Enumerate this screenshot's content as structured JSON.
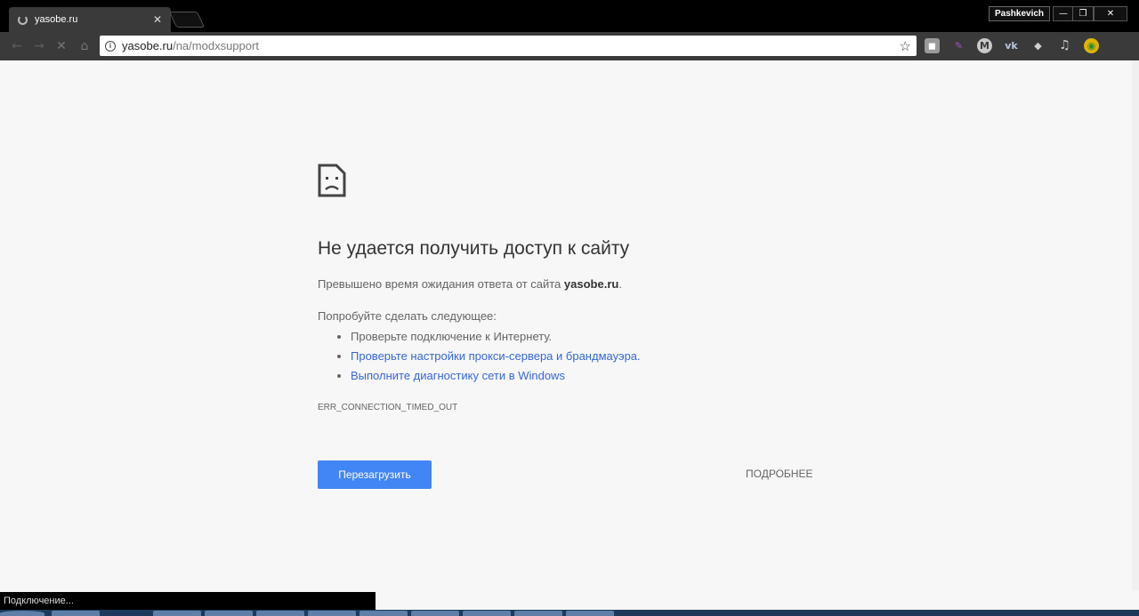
{
  "browser": {
    "tab_title": "yasobe.ru",
    "tab_close": "✕",
    "profile_name": "Pashkevich",
    "window_buttons": [
      "—",
      "❐",
      "✕"
    ],
    "url_host": "yasobe.ru",
    "url_path": "/na/modxsupport",
    "star_glyph": "☆",
    "extensions": [
      {
        "name": "rss-extension-icon",
        "color": "#9a9a9a",
        "glyph": "◼"
      },
      {
        "name": "feather-extension-icon",
        "color": "#8b3fb8",
        "glyph": "✎"
      },
      {
        "name": "m-extension-icon",
        "color": "#c8c8c8",
        "glyph": "M"
      },
      {
        "name": "vk-extension-icon",
        "color": "#5b7fa6",
        "glyph": "vk"
      },
      {
        "name": "layers-extension-icon",
        "color": "#d0d0d0",
        "glyph": "◆"
      },
      {
        "name": "music-extension-icon",
        "color": "#bbbbbb",
        "glyph": "♫"
      },
      {
        "name": "chrome-extension-icon",
        "color": "#e0b400",
        "glyph": "◉"
      }
    ]
  },
  "error": {
    "heading": "Не удается получить доступ к сайту",
    "summary_prefix": "Превышено время ожидания ответа от сайта ",
    "summary_host": "yasobe.ru",
    "summary_suffix": ".",
    "suggest_title": "Попробуйте сделать следующее:",
    "suggestions": [
      "Проверьте подключение к Интернету.",
      "Проверьте настройки прокси-сервера и брандмауэра.",
      "Выполните диагностику сети в Windows"
    ],
    "code": "ERR_CONNECTION_TIMED_OUT",
    "reload_label": "Перезагрузить",
    "details_label": "ПОДРОБНЕЕ"
  },
  "status": {
    "text": "Подключение..."
  }
}
